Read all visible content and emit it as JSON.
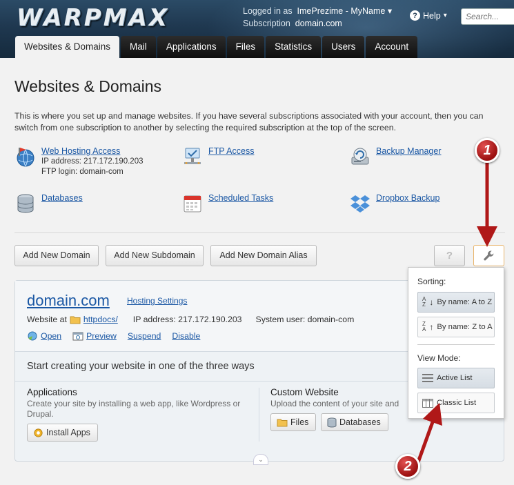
{
  "header": {
    "logo": "WARPMAX",
    "logged_in_label": "Logged in as",
    "user_name": "ImePrezime - MyName",
    "subscription_label": "Subscription",
    "subscription": "domain.com",
    "help_label": "Help",
    "search_placeholder": "Search..."
  },
  "tabs": [
    {
      "label": "Websites & Domains"
    },
    {
      "label": "Mail"
    },
    {
      "label": "Applications"
    },
    {
      "label": "Files"
    },
    {
      "label": "Statistics"
    },
    {
      "label": "Users"
    },
    {
      "label": "Account"
    }
  ],
  "page": {
    "title": "Websites & Domains",
    "intro": "This is where you set up and manage websites. If you have several subscriptions associated with your account, then you can switch from one subscription to another by selecting the required subscription at the top of the screen."
  },
  "quick_links": {
    "web_hosting": {
      "label": "Web Hosting Access",
      "ip": "IP address: 217.172.190.203",
      "ftp_login": "FTP login: domain-com"
    },
    "ftp": {
      "label": "FTP Access"
    },
    "backup": {
      "label": "Backup Manager"
    },
    "databases": {
      "label": "Databases"
    },
    "scheduled": {
      "label": "Scheduled Tasks"
    },
    "dropbox": {
      "label": "Dropbox Backup"
    }
  },
  "toolbar": {
    "add_domain": "Add New Domain",
    "add_subdomain": "Add New Subdomain",
    "add_alias": "Add New Domain Alias",
    "help_btn": "?"
  },
  "domain": {
    "name": "domain.com",
    "hosting_settings": "Hosting Settings",
    "website_at": "Website at",
    "docroot": "httpdocs/",
    "ip": "IP address: 217.172.190.203",
    "system_user": "System user: domain-com",
    "actions": {
      "open": "Open",
      "preview": "Preview",
      "suspend": "Suspend",
      "disable": "Disable"
    },
    "start_title": "Start creating your website in one of the three ways",
    "applications": {
      "title": "Applications",
      "desc": "Create your site by installing a web app, like Wordpress or Drupal.",
      "button": "Install Apps"
    },
    "custom": {
      "title": "Custom Website",
      "desc": "Upload the content of your site and",
      "files_button": "Files",
      "databases_button": "Databases"
    }
  },
  "dropdown": {
    "sorting_label": "Sorting:",
    "sort_az": "By name: A to Z",
    "sort_za": "By name: Z to A",
    "view_label": "View Mode:",
    "active_list": "Active List",
    "classic_list": "Classic List"
  },
  "annotations": {
    "marker1": "1",
    "marker2": "2"
  },
  "colors": {
    "link": "#1a57a4",
    "annotation": "#b01818",
    "header_bg": "#1f3850"
  }
}
